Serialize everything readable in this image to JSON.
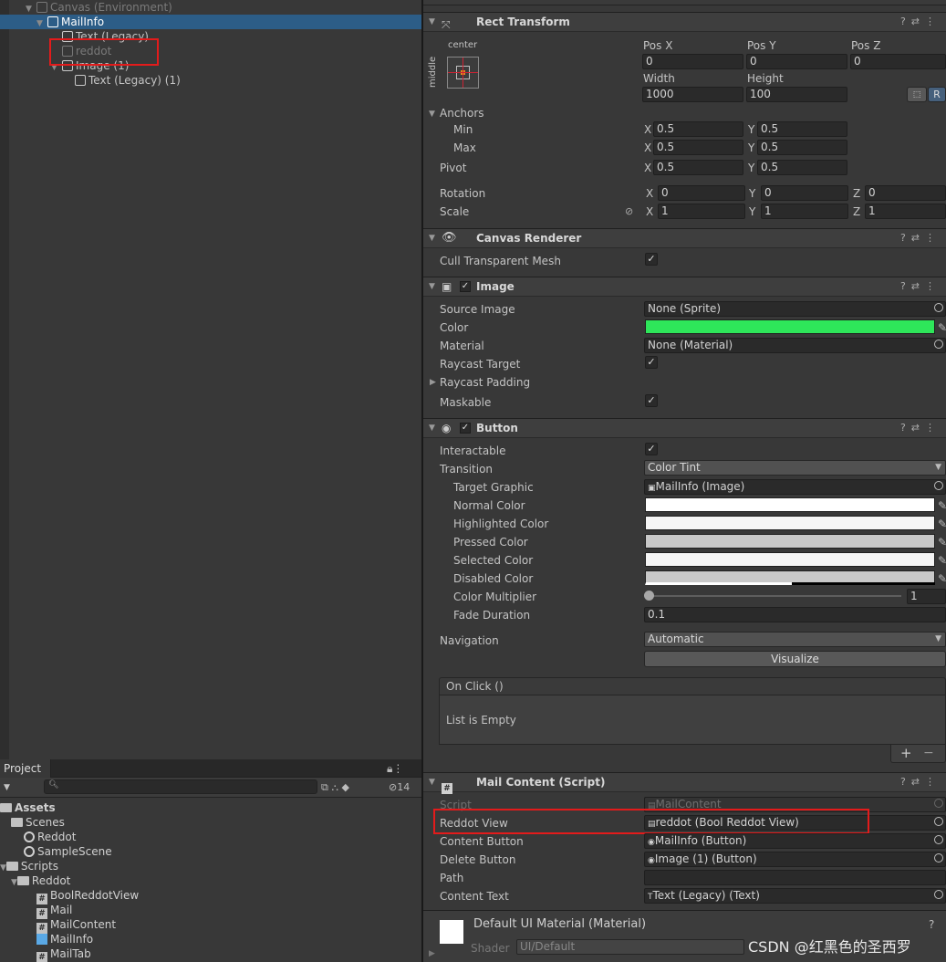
{
  "hierarchy": {
    "canvas": "Canvas (Environment)",
    "mailinfo": "MailInfo",
    "text_legacy": "Text (Legacy)",
    "reddot": "reddot",
    "image1": "Image (1)",
    "text_legacy1": "Text (Legacy) (1)"
  },
  "project": {
    "tab": "Project",
    "hidden_count": "14",
    "assets": "Assets",
    "scenes": "Scenes",
    "reddot_scene": "Reddot",
    "sample_scene": "SampleScene",
    "scripts": "Scripts",
    "reddot_folder": "Reddot",
    "files": [
      "BoolReddotView",
      "Mail",
      "MailContent",
      "MailInfo",
      "MailTab"
    ]
  },
  "rect_transform": {
    "title": "Rect Transform",
    "anchor_h": "center",
    "anchor_v": "middle",
    "pos_x_label": "Pos X",
    "pos_y_label": "Pos Y",
    "pos_z_label": "Pos Z",
    "pos_x": "0",
    "pos_y": "0",
    "pos_z": "0",
    "width_label": "Width",
    "height_label": "Height",
    "width": "1000",
    "height": "100",
    "r_button": "R",
    "anchors": "Anchors",
    "min": "Min",
    "max": "Max",
    "pivot": "Pivot",
    "x": "X",
    "y": "Y",
    "z": "Z",
    "min_x": "0.5",
    "min_y": "0.5",
    "max_x": "0.5",
    "max_y": "0.5",
    "pivot_x": "0.5",
    "pivot_y": "0.5",
    "rotation": "Rotation",
    "scale": "Scale",
    "rot_x": "0",
    "rot_y": "0",
    "rot_z": "0",
    "scale_x": "1",
    "scale_y": "1",
    "scale_z": "1"
  },
  "canvas_renderer": {
    "title": "Canvas Renderer",
    "cull": "Cull Transparent Mesh"
  },
  "image": {
    "title": "Image",
    "source_image": "Source Image",
    "source_value": "None (Sprite)",
    "color": "Color",
    "color_value": "#2ee65a",
    "material": "Material",
    "material_value": "None (Material)",
    "raycast_target": "Raycast Target",
    "raycast_padding": "Raycast Padding",
    "maskable": "Maskable"
  },
  "button": {
    "title": "Button",
    "interactable": "Interactable",
    "transition": "Transition",
    "transition_value": "Color Tint",
    "target_graphic": "Target Graphic",
    "target_value": "MailInfo (Image)",
    "normal": "Normal Color",
    "highlighted": "Highlighted Color",
    "pressed": "Pressed Color",
    "selected": "Selected Color",
    "disabled": "Disabled Color",
    "multiplier": "Color Multiplier",
    "multiplier_value": "1",
    "fade": "Fade Duration",
    "fade_value": "0.1",
    "navigation": "Navigation",
    "navigation_value": "Automatic",
    "visualize": "Visualize",
    "onclick": "On Click ()",
    "empty": "List is Empty",
    "plus": "+",
    "minus": "−"
  },
  "mail_content": {
    "title": "Mail Content (Script)",
    "script": "Script",
    "script_value": "MailContent",
    "reddot_view": "Reddot View",
    "reddot_value": "reddot (Bool Reddot View)",
    "content_button": "Content Button",
    "content_value": "MailInfo (Button)",
    "delete_button": "Delete Button",
    "delete_value": "Image (1) (Button)",
    "path": "Path",
    "path_value": "",
    "content_text": "Content Text",
    "content_text_value": "Text (Legacy) (Text)"
  },
  "material_footer": {
    "title": "Default UI Material (Material)",
    "shader": "Shader",
    "shader_value": "UI/Default"
  },
  "watermark": "CSDN @红黑色的圣西罗"
}
